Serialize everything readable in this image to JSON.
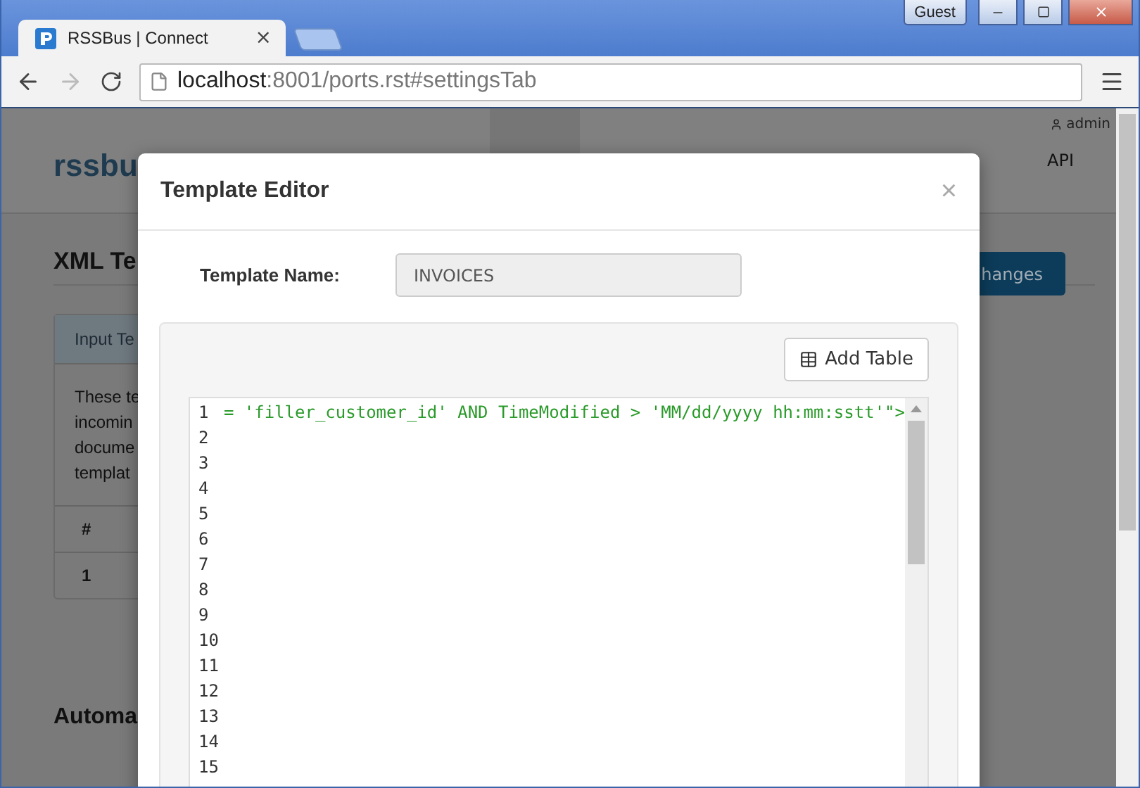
{
  "browser": {
    "tab_title": "RSSBus | Connect",
    "tab_close": "×",
    "guest": "Guest",
    "url_host": "localhost",
    "url_rest": ":8001/ports.rst#settingsTab"
  },
  "page": {
    "logo": "rssbu",
    "user": "admin",
    "nav_item": "API",
    "heading": "XML Te",
    "panel_title": "Input Te",
    "panel_text": [
      "These te",
      "incomin",
      "docume",
      "templat"
    ],
    "table_header": "#",
    "table_row": "1",
    "save_button": "hanges",
    "section_heading": "Automa"
  },
  "modal": {
    "title": "Template Editor",
    "close": "×",
    "name_label": "Template Name:",
    "name_value": "INVOICES",
    "add_table": "Add Table",
    "code_line": "= 'filler_customer_id' AND TimeModified > 'MM/dd/yyyy hh:mm:sstt'\">",
    "line_numbers": [
      "1",
      "2",
      "3",
      "4",
      "5",
      "6",
      "7",
      "8",
      "9",
      "10",
      "11",
      "12",
      "13",
      "14",
      "15"
    ]
  }
}
